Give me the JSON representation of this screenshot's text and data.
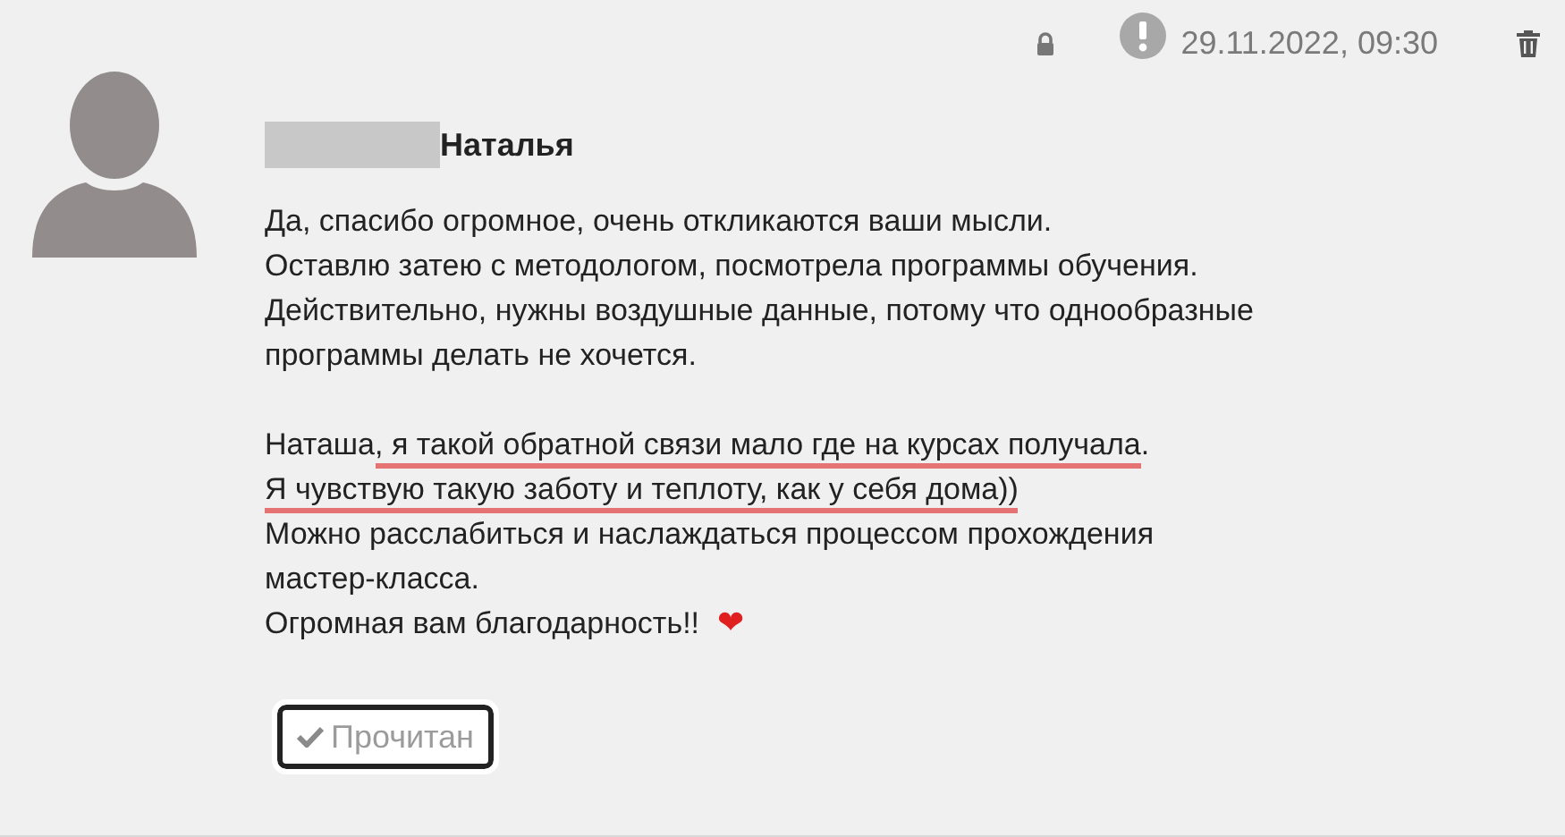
{
  "header": {
    "timestamp": "29.11.2022, 09:30"
  },
  "author": {
    "name": "Наталья"
  },
  "message": {
    "paragraphs": [
      [
        [
          {
            "text": "Да, спасибо огромное, очень откликаются ваши мысли.",
            "marked": false
          }
        ],
        [
          {
            "text": "Оставлю затею с методологом, посмотрела программы обучения.",
            "marked": false
          }
        ],
        [
          {
            "text": "Действительно, нужны воздушные данные, потому что однообразные",
            "marked": false
          }
        ],
        [
          {
            "text": "программы делать не хочется.",
            "marked": false
          }
        ]
      ],
      [
        [
          {
            "text": "Наташа",
            "marked": false
          },
          {
            "text": ", я такой обратной связи мало где на курсах получала",
            "marked": true
          },
          {
            "text": ".",
            "marked": false
          }
        ],
        [
          {
            "text": "Я чувствую такую заботу и теплоту, как у себя дома))",
            "marked": true
          }
        ],
        [
          {
            "text": "Можно расслабиться и наслаждаться процессом прохождения",
            "marked": false
          }
        ],
        [
          {
            "text": "мастер-класса.",
            "marked": false
          }
        ],
        [
          {
            "text": "Огромная вам благодарность!!",
            "marked": false,
            "emoji": "❤"
          }
        ]
      ]
    ]
  },
  "read_button": {
    "label": "Прочитан"
  }
}
